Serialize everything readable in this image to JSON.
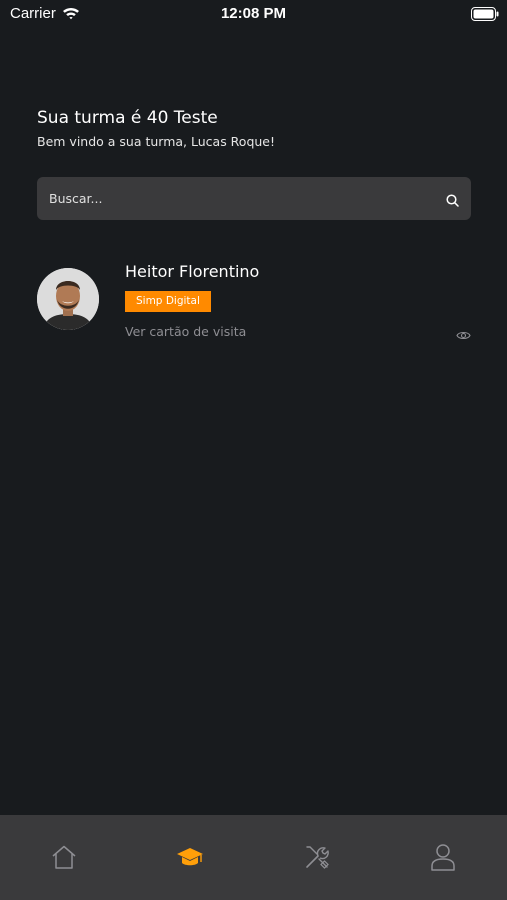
{
  "status_bar": {
    "carrier": "Carrier",
    "time": "12:08 PM"
  },
  "header": {
    "title": "Sua turma é 40 Teste",
    "subtitle": "Bem vindo a sua turma, Lucas Roque!"
  },
  "search": {
    "placeholder": "Buscar...",
    "value": ""
  },
  "members": [
    {
      "name": "Heitor Florentino",
      "badge": "Simp Digital",
      "link_label": "Ver cartão de visita"
    }
  ],
  "tab_bar": {
    "tabs": [
      {
        "icon": "home-icon",
        "active": false
      },
      {
        "icon": "graduation-cap-icon",
        "active": true
      },
      {
        "icon": "tools-icon",
        "active": false
      },
      {
        "icon": "user-icon",
        "active": false
      }
    ]
  },
  "colors": {
    "background": "#181b1e",
    "surface": "#3a3a3c",
    "accent": "#ff8a00",
    "muted": "#8e8e93"
  }
}
